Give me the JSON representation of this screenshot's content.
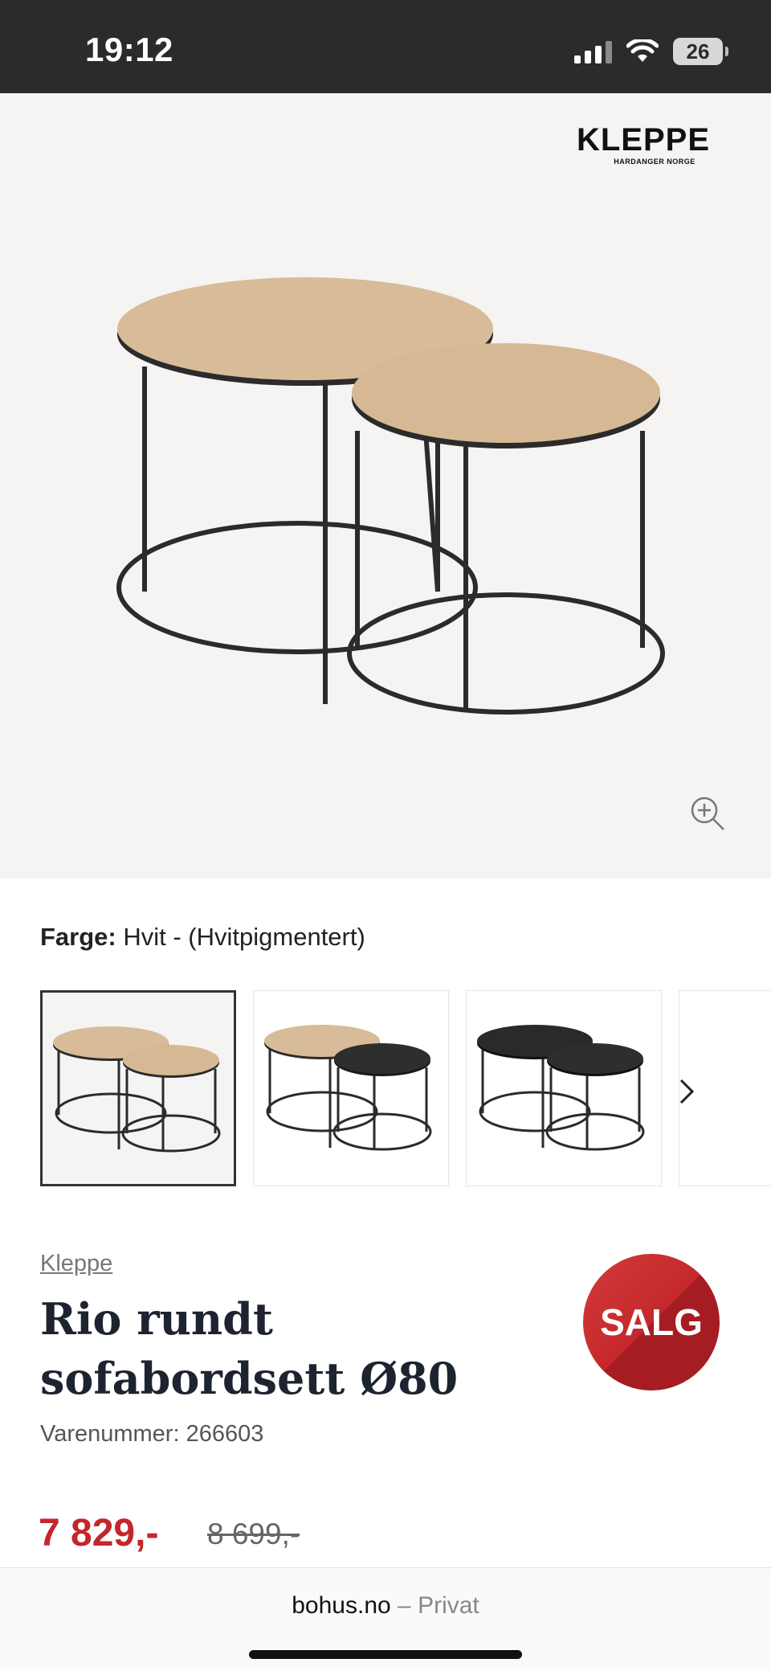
{
  "status": {
    "time": "19:12",
    "battery": "26"
  },
  "brand_logo": {
    "name": "KLEPPE",
    "tagline": "HARDANGER NORGE"
  },
  "color": {
    "label": "Farge:",
    "value": "Hvit - (Hvitpigmentert)"
  },
  "swatches": [
    {
      "name": "Hvit oak / oak",
      "top_a": "#d8bb98",
      "top_b": "#d8bb98",
      "active": true
    },
    {
      "name": "Oak / black",
      "top_a": "#d8bb98",
      "top_b": "#2a2a2a",
      "active": false
    },
    {
      "name": "Black / black",
      "top_a": "#2a2a2a",
      "top_b": "#2a2a2a",
      "active": false
    }
  ],
  "product": {
    "brand": "Kleppe",
    "title": "Rio rundt sofabordsett Ø80",
    "sku": "Varenummer: 266603",
    "sale_badge": "SALG",
    "price_now": "7 829,-",
    "price_old": "8 699,-"
  },
  "browser": {
    "domain": "bohus.no",
    "separator": " – ",
    "section": "Privat"
  },
  "icons": [
    "signal-icon",
    "wifi-icon",
    "battery-icon",
    "zoom-in-icon",
    "chevron-right-icon"
  ],
  "colors": {
    "status_bar": "#2b2b2d",
    "sale_red": "#c4262b",
    "title": "#1d2430",
    "wood": "#d8bb98"
  }
}
